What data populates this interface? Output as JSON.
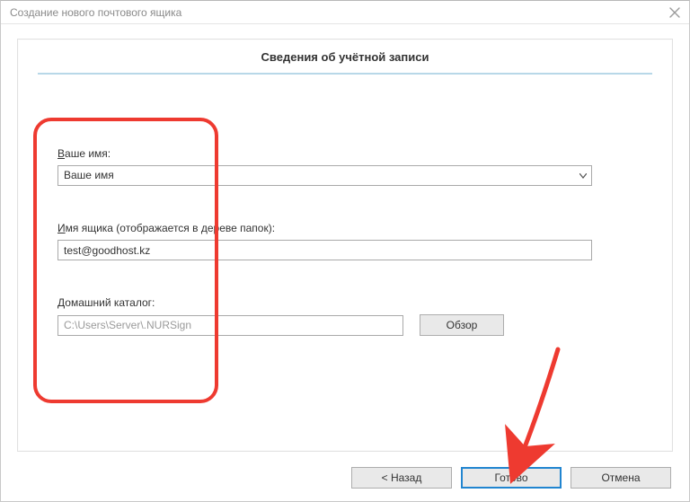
{
  "window": {
    "title": "Создание нового почтового ящика"
  },
  "panel": {
    "heading": "Сведения об учётной записи"
  },
  "fields": {
    "name": {
      "label_prefix": "В",
      "label_rest": "аше имя:",
      "value": "Ваше имя"
    },
    "mailbox": {
      "label_prefix": "И",
      "label_rest": "мя ящика (отображается в дереве папок):",
      "value": "test@goodhost.kz"
    },
    "home": {
      "label_prefix": "Д",
      "label_rest": "омашний каталог:",
      "value": "C:\\Users\\Server\\.NURSign",
      "browse": "Обзор"
    }
  },
  "buttons": {
    "back": "<  Назад",
    "finish": "Готово",
    "cancel": "Отмена"
  }
}
